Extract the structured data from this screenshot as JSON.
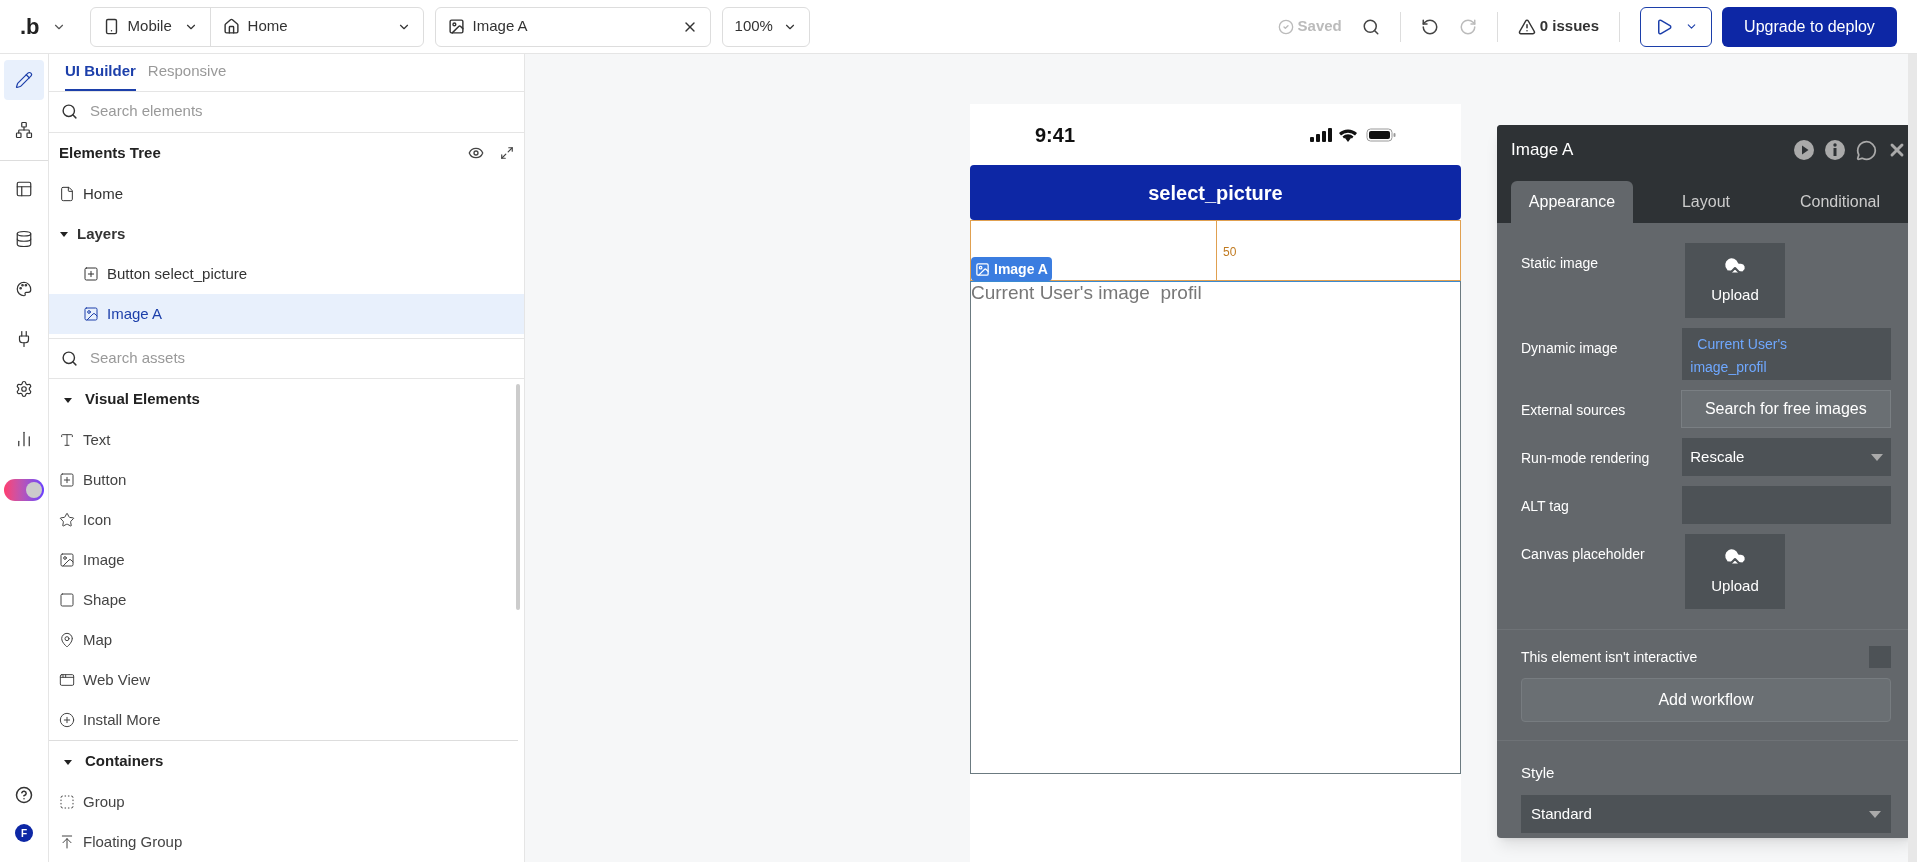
{
  "top_bar": {
    "logo": ".b",
    "device": "Mobile",
    "page": "Home",
    "element": "Image A",
    "zoom": "100%",
    "saved": "Saved",
    "issues": "0 issues",
    "deploy_button": "Upgrade to deploy"
  },
  "rail": [
    {
      "kind": "design",
      "selected": true
    },
    {
      "kind": "workflow",
      "selected": false
    },
    {
      "kind": "layout",
      "selected": false
    },
    {
      "kind": "data",
      "selected": false
    },
    {
      "kind": "styles",
      "selected": false
    },
    {
      "kind": "plugins",
      "selected": false
    },
    {
      "kind": "settings",
      "selected": false
    },
    {
      "kind": "logs",
      "selected": false
    }
  ],
  "mode_toggle": {
    "on": true
  },
  "user_avatar": "F",
  "sidebar": {
    "tabs": [
      {
        "label": "UI Builder",
        "selected": true
      },
      {
        "label": "Responsive",
        "selected": false
      }
    ],
    "search_placeholder": "Search elements",
    "tree_title": "Elements Tree",
    "tree": [
      {
        "label": "Home",
        "kind": "page",
        "selected": false
      },
      {
        "label": "Layers",
        "kind": "folder",
        "expanded": true,
        "children": [
          {
            "label": "Button select_picture",
            "kind": "button",
            "selected": false
          },
          {
            "label": "Image A",
            "kind": "image",
            "selected": true
          }
        ]
      }
    ],
    "assets_placeholder": "Search assets",
    "sections": [
      {
        "title": "Visual Elements",
        "expanded": true,
        "items": [
          {
            "label": "Text",
            "kind": "text"
          },
          {
            "label": "Button",
            "kind": "button"
          },
          {
            "label": "Icon",
            "kind": "icon"
          },
          {
            "label": "Image",
            "kind": "image"
          },
          {
            "label": "Shape",
            "kind": "shape"
          },
          {
            "label": "Map",
            "kind": "map"
          },
          {
            "label": "Web View",
            "kind": "webview"
          },
          {
            "label": "Install More",
            "kind": "install"
          }
        ]
      },
      {
        "title": "Containers",
        "expanded": true,
        "items": [
          {
            "label": "Group",
            "kind": "group"
          },
          {
            "label": "Floating Group",
            "kind": "floating"
          }
        ]
      }
    ]
  },
  "canvas": {
    "status_time": "9:41",
    "button": "select_picture",
    "ruler_value": "50",
    "image_tag": "Image A",
    "image_placeholder": "Current User's image  profil"
  },
  "panel": {
    "title": "Image A",
    "tabs": [
      {
        "label": "Appearance",
        "selected": true
      },
      {
        "label": "Layout",
        "selected": false
      },
      {
        "label": "Conditional",
        "selected": false
      }
    ],
    "rows": [
      {
        "kind": "upload",
        "label": "Static image",
        "value": "Upload"
      },
      {
        "kind": "dynamic",
        "label": "Dynamic image",
        "value": "Current User's image_profil"
      },
      {
        "kind": "button",
        "label": "External sources",
        "value": "Search for free images"
      },
      {
        "kind": "dropdown",
        "label": "Run-mode rendering",
        "value": "Rescale"
      },
      {
        "kind": "input",
        "label": "ALT tag"
      },
      {
        "kind": "upload",
        "label": "Canvas placeholder",
        "value": "Upload"
      }
    ],
    "interactive": {
      "label": "This element isn't interactive",
      "checked": false
    },
    "workflow_button": "Add workflow",
    "style_label": "Style",
    "style_value": "Standard"
  }
}
